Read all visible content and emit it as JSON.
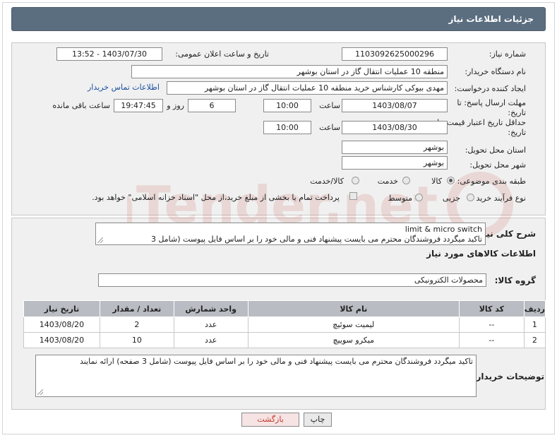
{
  "header": {
    "title": "جزئیات اطلاعات نیاز"
  },
  "form": {
    "need_number_label": "شماره نیاز:",
    "need_number": "1103092625000296",
    "announce_label": "تاریخ و ساعت اعلان عمومی:",
    "announce_value": "1403/07/30 - 13:52",
    "buyer_org_label": "نام دستگاه خریدار:",
    "buyer_org": "منطقه 10 عملیات انتقال گاز در استان بوشهر",
    "creator_label": "ایجاد کننده درخواست:",
    "creator": "مهدی بیوکی کارشناس خرید منطقه 10 عملیات انتقال گاز در استان بوشهر",
    "contact_link": "اطلاعات تماس خریدار",
    "deadline_label_1": "مهلت ارسال پاسخ: تا",
    "deadline_label_2": "تاریخ:",
    "deadline_date": "1403/08/07",
    "time_label": "ساعت",
    "deadline_time": "10:00",
    "days_value": "6",
    "days_label": "روز و",
    "remaining_time": "19:47:45",
    "remaining_label": "ساعت باقی مانده",
    "validity_label_1": "حداقل تاریخ اعتبار قیمت: تا",
    "validity_label_2": "تاریخ:",
    "validity_date": "1403/08/30",
    "validity_time": "10:00",
    "province_label": "استان محل تحویل:",
    "province": "بوشهر",
    "city_label": "شهر محل تحویل:",
    "city": "بوشهر",
    "category_label": "طبقه بندی موضوعی:",
    "category_options": [
      "کالا",
      "خدمت",
      "کالا/خدمت"
    ],
    "category_selected": "کالا",
    "process_label": "نوع فرآیند خرید :",
    "process_options": [
      "جزیی",
      "متوسط"
    ],
    "process_selected": "",
    "payment_note": "پرداخت تمام یا بخشی از مبلغ خرید،از محل \"اسناد خزانه اسلامی\" خواهد بود."
  },
  "summary": {
    "label": "شرح کلی نیاز:",
    "line1": "limit & micro switch",
    "line2": "تاکید میگردد فروشندگان محترم می بایست پیشنهاد فنی و مالی خود را بر اساس فایل پیوست (شامل 3"
  },
  "goods": {
    "section_title": "اطلاعات کالاهای مورد نیاز",
    "group_label": "گروه کالا:",
    "group_value": "محصولات الکترونیکی",
    "columns": [
      "ردیف",
      "کد کالا",
      "نام کالا",
      "واحد شمارش",
      "تعداد / مقدار",
      "تاریخ نیاز"
    ],
    "rows": [
      [
        "1",
        "--",
        "لیمیت سوئیچ",
        "عدد",
        "2",
        "1403/08/20"
      ],
      [
        "2",
        "--",
        "میکرو سوییچ",
        "عدد",
        "10",
        "1403/08/20"
      ]
    ]
  },
  "buyer_notes": {
    "label": "توضیحات خریدار:",
    "text": "تاکید میگردد فروشندگان محترم می بایست پیشنهاد فنی و مالی خود را بر اساس فایل پیوست (شامل 3 صفحه) ارائه نمایند"
  },
  "buttons": {
    "print": "چاپ",
    "back": "بازگشت"
  },
  "watermark_text": "AriaTender.net",
  "colors": {
    "header_bg": "#5b6e80",
    "panel_bg": "#f0f0f0",
    "table_header": "#b9bcc2",
    "link": "#1a4fa0"
  }
}
